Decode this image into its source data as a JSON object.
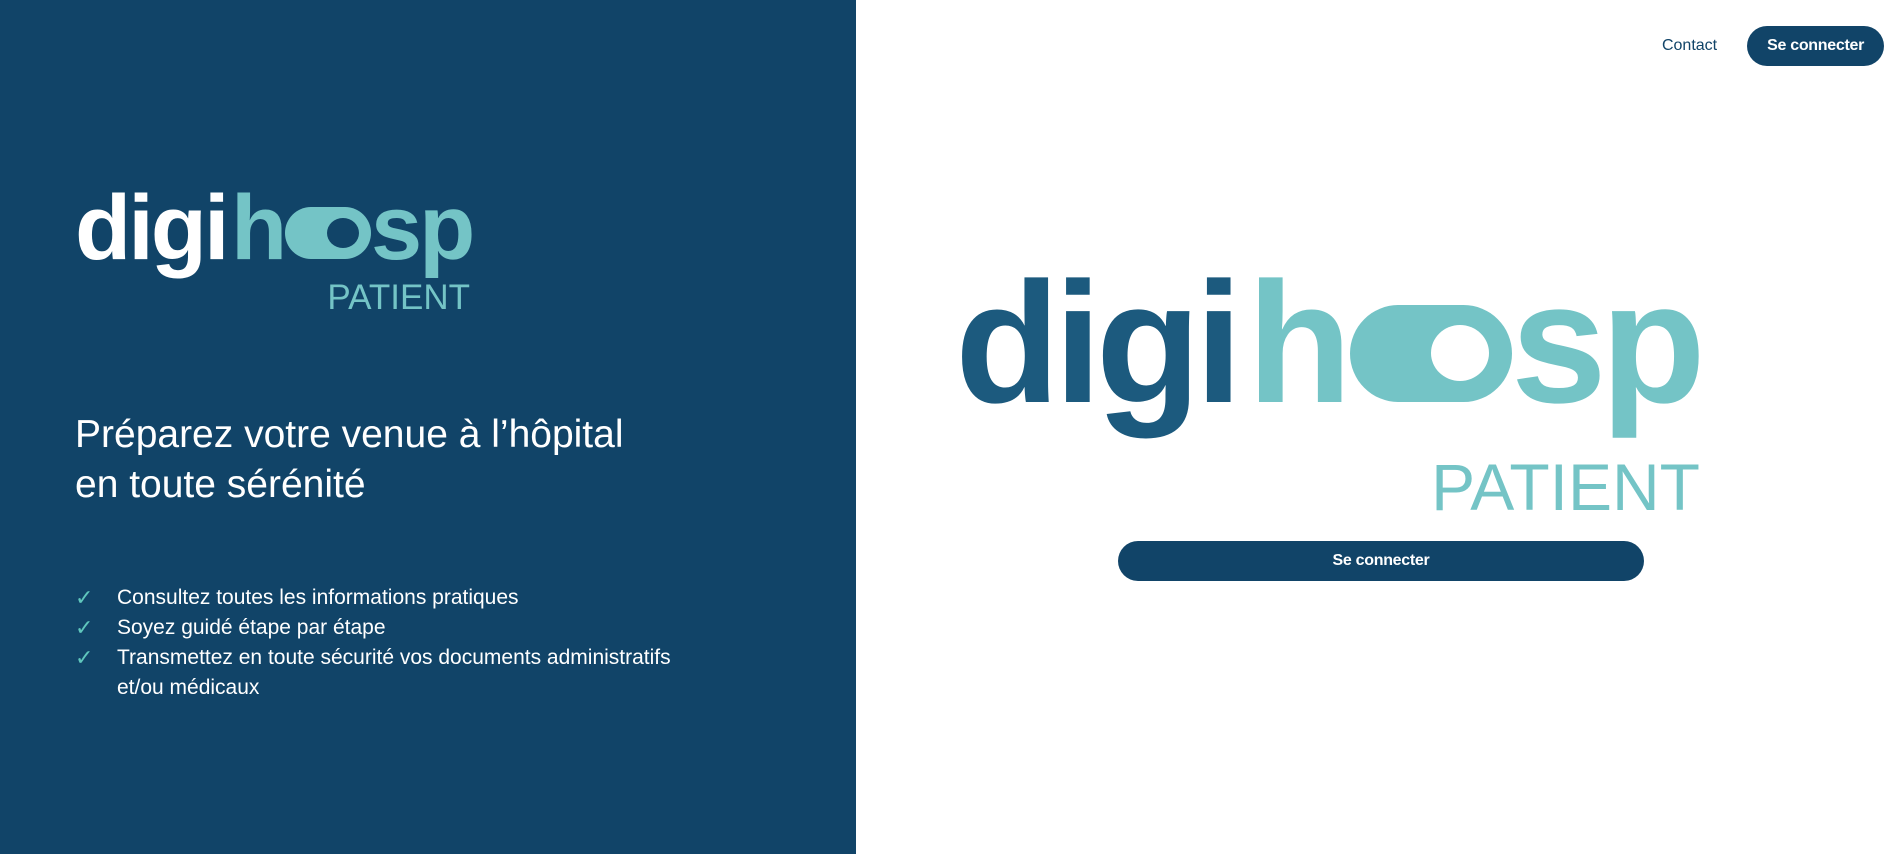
{
  "brand": {
    "name_part1": "digi",
    "name_part2": "hosp",
    "product": "PATIENT",
    "colors": {
      "navy": "#114468",
      "teal": "#74c4c6",
      "dark_blue_text": "#1c5a7e",
      "check": "#5fc6bc"
    }
  },
  "header": {
    "contact_label": "Contact",
    "connect_label": "Se connecter"
  },
  "left_panel": {
    "tagline_line1": "Préparez votre venue à l’hôpital",
    "tagline_line2": "en toute sérénité",
    "check_icon": "check-icon",
    "features": [
      "Consultez toutes les informations pratiques",
      "Soyez guidé étape par étape",
      "Transmettez en toute sécurité vos documents administratifs et/ou médicaux"
    ]
  },
  "main": {
    "connect_label": "Se connecter"
  }
}
